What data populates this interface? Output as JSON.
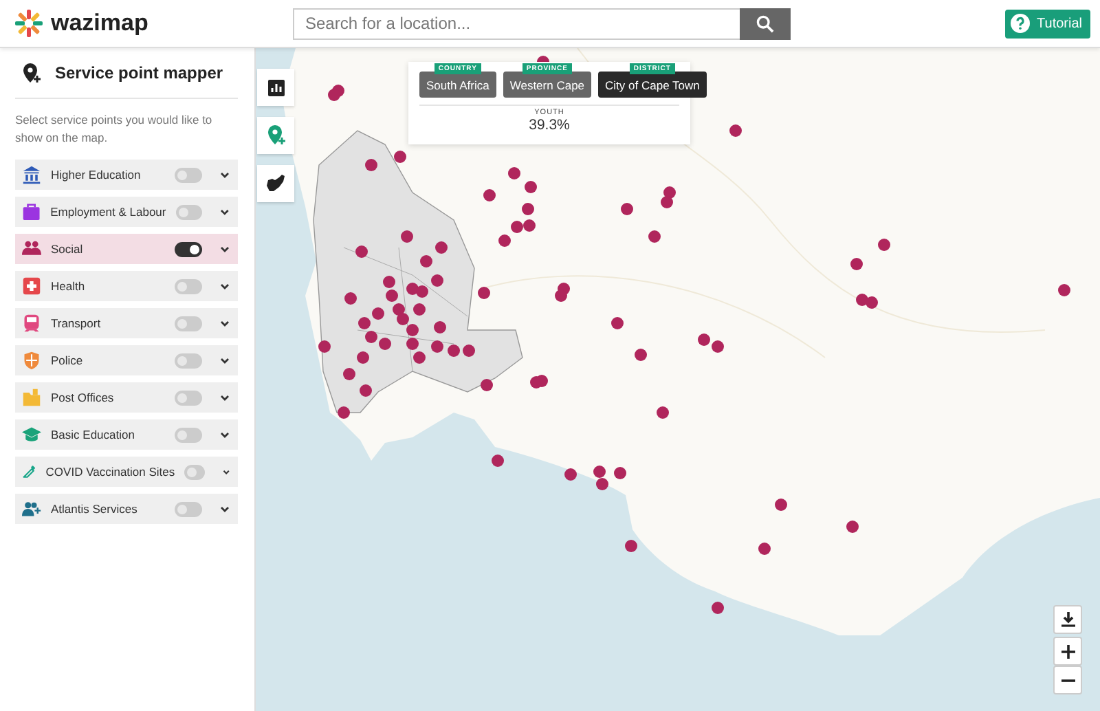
{
  "header": {
    "logo": "wazimap",
    "search": {
      "placeholder": "Search for a location..."
    },
    "tutorial_button": "Tutorial"
  },
  "sidebar": {
    "title": "Service point mapper",
    "description": "Select service points you would like to show on the map.",
    "items": [
      {
        "label": "Higher Education",
        "kind": "university",
        "on": false
      },
      {
        "label": "Employment & Labour",
        "kind": "briefcase",
        "on": false
      },
      {
        "label": "Social",
        "kind": "people",
        "on": true
      },
      {
        "label": "Health",
        "kind": "cross",
        "on": false
      },
      {
        "label": "Transport",
        "kind": "train",
        "on": false
      },
      {
        "label": "Police",
        "kind": "shield",
        "on": false
      },
      {
        "label": "Post Offices",
        "kind": "folder",
        "on": false
      },
      {
        "label": "Basic Education",
        "kind": "graduation",
        "on": false
      },
      {
        "label": "COVID Vaccination Sites",
        "kind": "syringe",
        "on": false
      },
      {
        "label": "Atlantis Services",
        "kind": "userplus",
        "on": false
      }
    ]
  },
  "map": {
    "breadcrumbs": [
      {
        "level": "COUNTRY",
        "name": "South Africa",
        "selected": false
      },
      {
        "level": "PROVINCE",
        "name": "Western Cape",
        "selected": false
      },
      {
        "level": "DISTRICT",
        "name": "City of Cape Town",
        "selected": true
      }
    ],
    "metric": {
      "label": "YOUTH",
      "value": "39.3%"
    }
  }
}
